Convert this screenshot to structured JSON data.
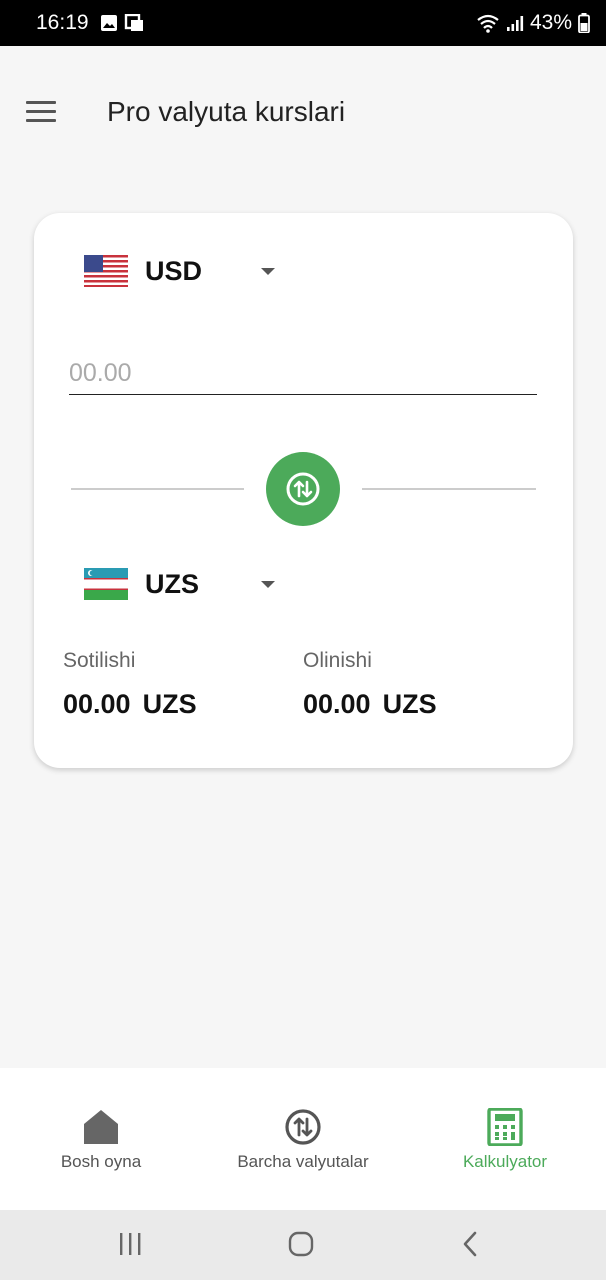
{
  "status_bar": {
    "time": "16:19",
    "battery": "43%"
  },
  "app_bar": {
    "title": "Pro valyuta kurslari"
  },
  "converter": {
    "from": {
      "code": "USD"
    },
    "amount_placeholder": "00.00",
    "to": {
      "code": "UZS"
    },
    "sell": {
      "label": "Sotilishi",
      "value": "00.00",
      "unit": "UZS"
    },
    "buy": {
      "label": "Olinishi",
      "value": "00.00",
      "unit": "UZS"
    }
  },
  "bottom_nav": {
    "items": [
      {
        "label": "Bosh oyna",
        "icon": "home-icon"
      },
      {
        "label": "Barcha valyutalar",
        "icon": "swap-icon"
      },
      {
        "label": "Kalkulyator",
        "icon": "calculator-icon",
        "active": true
      }
    ]
  },
  "colors": {
    "accent": "#4caa5a",
    "background": "#f6f6f6"
  }
}
